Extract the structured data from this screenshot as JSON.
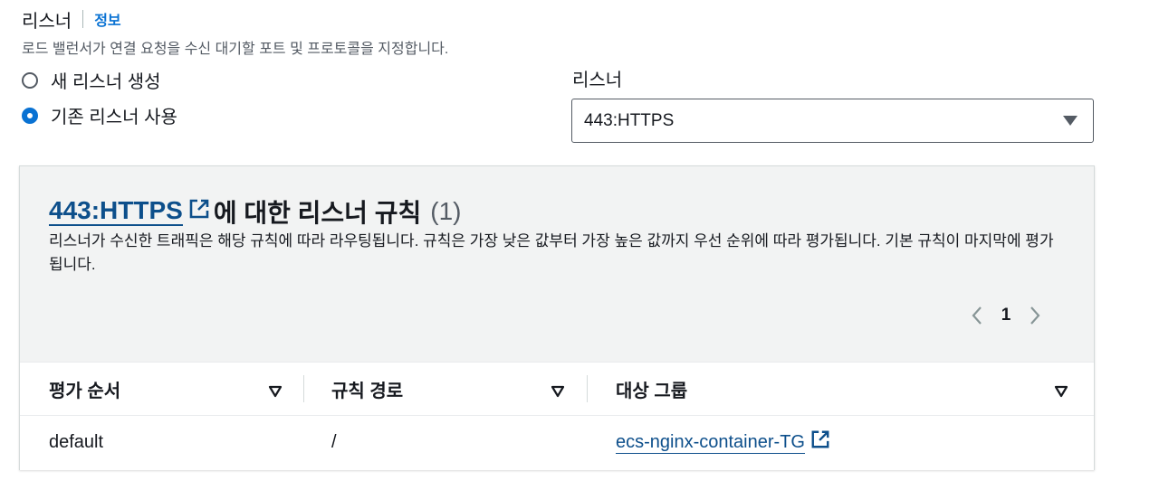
{
  "section": {
    "title": "리스너",
    "info_link": "정보",
    "description": "로드 밸런서가 연결 요청을 수신 대기할 포트 및 프로토콜을 지정합니다."
  },
  "radios": {
    "new_listener": "새 리스너 생성",
    "existing_listener": "기존 리스너 사용",
    "selected": "existing_listener"
  },
  "listener_select": {
    "label": "리스너",
    "value": "443:HTTPS"
  },
  "rules_panel": {
    "title_link": "443:HTTPS",
    "title_text": "에 대한 리스너 규칙",
    "count": "(1)",
    "description": "리스너가 수신한 트래픽은 해당 규칙에 따라 라우팅됩니다. 규칙은 가장 낮은 값부터 가장 높은 값까지 우선 순위에 따라 평가됩니다. 기본 규칙이 마지막에 평가됩니다.",
    "pagination": {
      "current_page": "1"
    },
    "table": {
      "columns": [
        "평가 순서",
        "규칙 경로",
        "대상 그룹"
      ],
      "rows": [
        {
          "order": "default",
          "path": "/",
          "target_group": "ecs-nginx-container-TG"
        }
      ]
    }
  },
  "colors": {
    "link": "#0d4f8b",
    "info": "#0972d3",
    "panel_bg": "#f2f3f3",
    "text": "#16191f"
  }
}
